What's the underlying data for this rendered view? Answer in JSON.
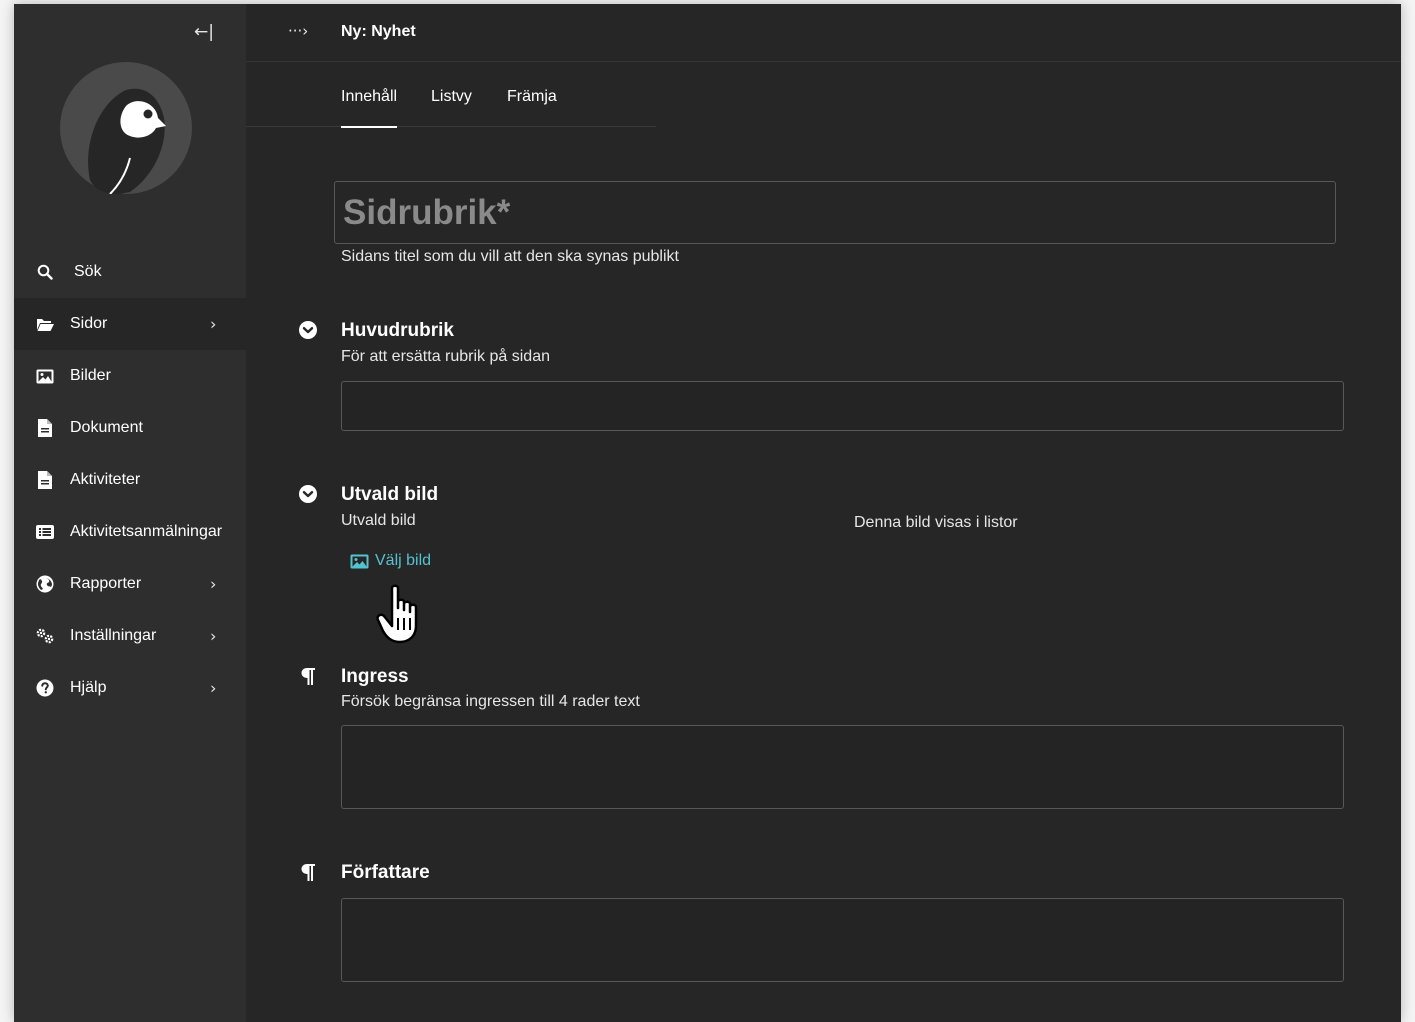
{
  "sidebar": {
    "collapse_label": "←|",
    "items": [
      {
        "label": "Sök",
        "icon": "search-icon"
      },
      {
        "label": "Sidor",
        "icon": "folder-open-icon",
        "chevron": "›",
        "active": true
      },
      {
        "label": "Bilder",
        "icon": "image-icon"
      },
      {
        "label": "Dokument",
        "icon": "document-icon"
      },
      {
        "label": "Aktiviteter",
        "icon": "document-icon"
      },
      {
        "label": "Aktivitetsanmälningar",
        "icon": "list-icon"
      },
      {
        "label": "Rapporter",
        "icon": "globe-icon",
        "chevron": "›"
      },
      {
        "label": "Inställningar",
        "icon": "cogs-icon",
        "chevron": "›"
      },
      {
        "label": "Hjälp",
        "icon": "help-icon",
        "chevron": "›"
      }
    ]
  },
  "header": {
    "breadcrumb_toggle": "···›",
    "title": "Ny: Nyhet"
  },
  "tabs": [
    {
      "label": "Innehåll",
      "active": true
    },
    {
      "label": "Listvy"
    },
    {
      "label": "Främja"
    }
  ],
  "form": {
    "title_placeholder": "Sidrubrik*",
    "title_help": "Sidans titel som du vill att den ska synas publikt",
    "headline": {
      "title": "Huvudrubrik",
      "help": "För att ersätta rubrik på sidan"
    },
    "featured_image": {
      "title": "Utvald bild",
      "label": "Utvald bild",
      "help": "Denna bild visas i listor",
      "choose_label": "Välj bild"
    },
    "intro": {
      "title": "Ingress",
      "help": "Försök begränsa ingressen till 4 rader text"
    },
    "author": {
      "title": "Författare"
    }
  },
  "colors": {
    "background": "#262626",
    "sidebar": "#2e2e2e",
    "accent": "#55c2d0",
    "border": "#585858"
  }
}
